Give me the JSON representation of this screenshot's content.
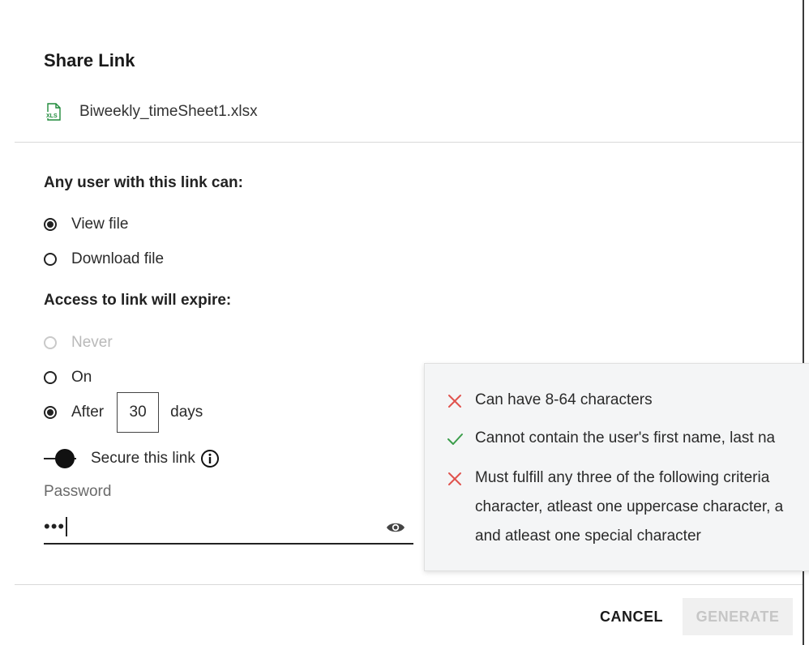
{
  "dialog": {
    "title": "Share Link",
    "file_name": "Biweekly_timeSheet1.xlsx",
    "file_icon": "xls-file-icon"
  },
  "permissions": {
    "label": "Any user with this link can:",
    "options": [
      {
        "label": "View file",
        "checked": true
      },
      {
        "label": "Download file",
        "checked": false
      }
    ]
  },
  "expiry": {
    "label": "Access to link will expire:",
    "never_label": "Never",
    "on_label": "On",
    "after_label": "After",
    "after_value": "30",
    "days_label": "days",
    "selected": "After"
  },
  "secure": {
    "label": "Secure this link",
    "enabled": true,
    "password_label": "Password",
    "password_value": "•••"
  },
  "password_rules": [
    {
      "status": "fail",
      "icon": "x-icon",
      "lines": [
        "Can have 8-64 characters"
      ]
    },
    {
      "status": "pass",
      "icon": "check-icon",
      "lines": [
        "Cannot contain the user's first name, last na"
      ]
    },
    {
      "status": "fail",
      "icon": "x-icon",
      "lines": [
        "Must fulfill any three of the following criteria",
        "character, atleast one uppercase character, a",
        "and atleast one special character"
      ]
    }
  ],
  "footer": {
    "cancel_label": "CANCEL",
    "generate_label": "GENERATE"
  },
  "colors": {
    "fail": "#e0524d",
    "pass": "#3a9d4a",
    "xls_green": "#1e8a3a",
    "disabled_text": "#b9b9b9"
  }
}
